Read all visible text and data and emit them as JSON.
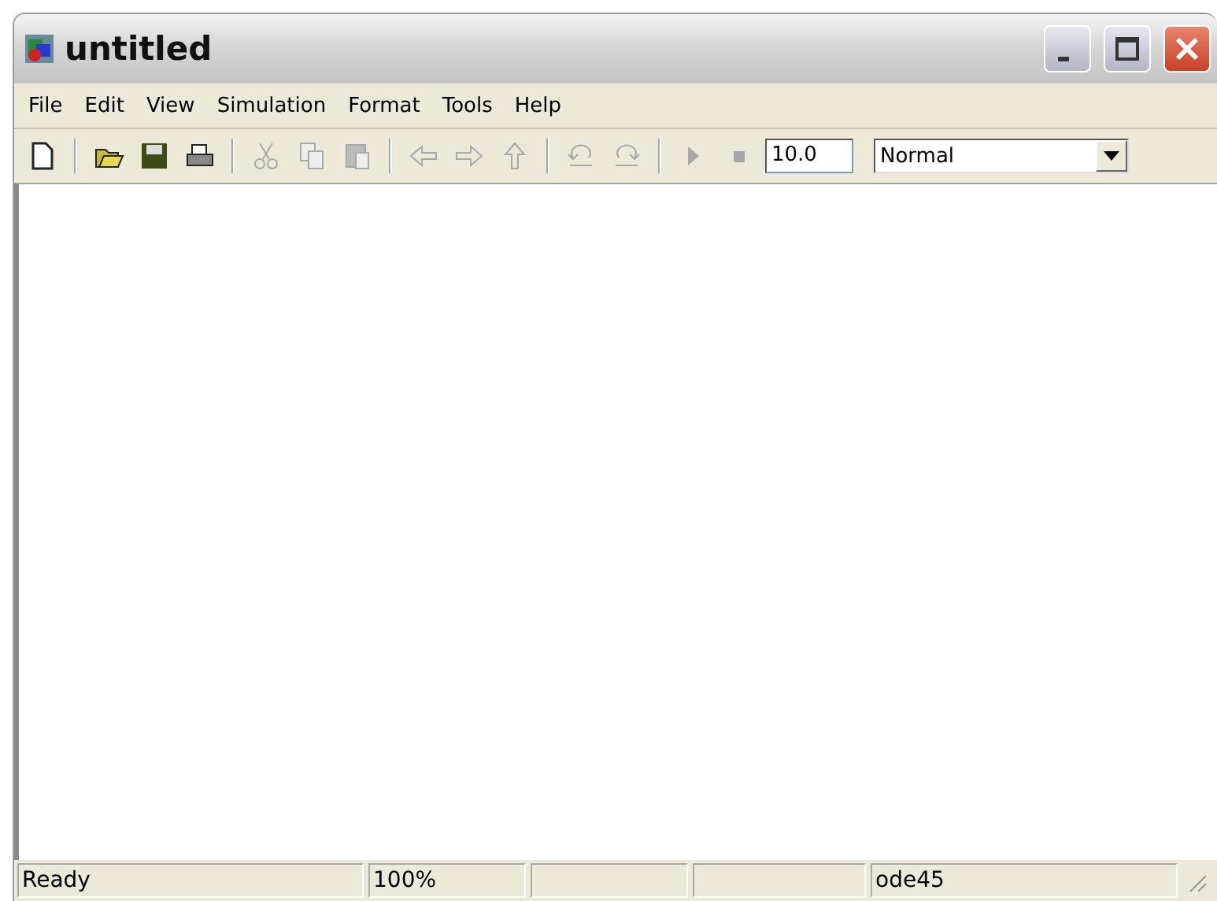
{
  "window": {
    "title": "untitled"
  },
  "menu": [
    "File",
    "Edit",
    "View",
    "Simulation",
    "Format",
    "Tools",
    "Help"
  ],
  "toolbar": [
    {
      "kind": "new",
      "disabled": false
    },
    {
      "kind": "sep"
    },
    {
      "kind": "open",
      "disabled": false
    },
    {
      "kind": "save",
      "disabled": false
    },
    {
      "kind": "print",
      "disabled": false
    },
    {
      "kind": "sep"
    },
    {
      "kind": "cut",
      "disabled": true
    },
    {
      "kind": "copy",
      "disabled": true
    },
    {
      "kind": "paste",
      "disabled": true
    },
    {
      "kind": "sep"
    },
    {
      "kind": "back",
      "disabled": true
    },
    {
      "kind": "forward",
      "disabled": true
    },
    {
      "kind": "up",
      "disabled": true
    },
    {
      "kind": "sep"
    },
    {
      "kind": "undo",
      "disabled": true
    },
    {
      "kind": "redo",
      "disabled": true
    },
    {
      "kind": "sep"
    },
    {
      "kind": "play",
      "disabled": true
    },
    {
      "kind": "stop",
      "disabled": true
    }
  ],
  "stop_time": {
    "value": "10.0"
  },
  "mode": {
    "value": "Normal"
  },
  "status_bar": {
    "message": "Ready",
    "zoom": "100%",
    "solver": "ode45"
  }
}
